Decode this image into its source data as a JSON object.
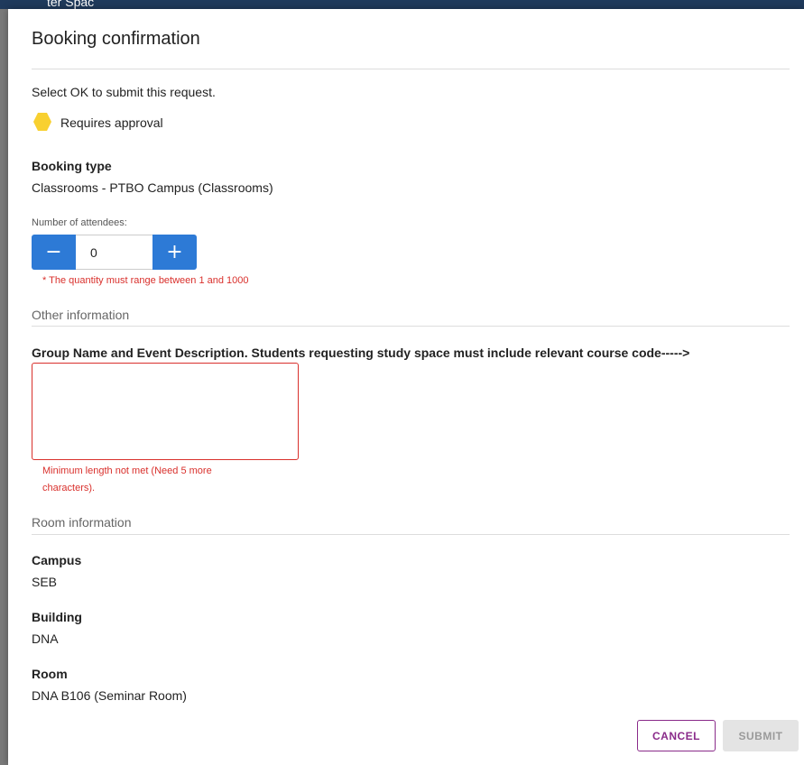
{
  "background": {
    "partial_text": "ter Spac"
  },
  "dialog": {
    "title": "Booking confirmation",
    "instruction": "Select OK to submit this request.",
    "approval": {
      "icon": "hexagon-icon",
      "color": "#f8d030",
      "label": "Requires approval"
    },
    "booking_type": {
      "label": "Booking type",
      "value": "Classrooms - PTBO Campus (Classrooms)"
    },
    "attendees": {
      "label": "Number of attendees:",
      "value": "0",
      "decrement": "−",
      "increment": "+",
      "error": "* The quantity must range between 1 and 1000"
    },
    "other_info": {
      "heading": "Other information",
      "question": "Group Name and Event Description. Students requesting study space must include relevant course code----->",
      "value": "",
      "error_line1": "Minimum length not met (Need 5 more",
      "error_line2": "characters)."
    },
    "room_info": {
      "heading": "Room information",
      "campus_label": "Campus",
      "campus_value": "SEB",
      "building_label": "Building",
      "building_value": "DNA",
      "room_label": "Room",
      "room_value": "DNA B106 (Seminar Room)"
    },
    "buttons": {
      "cancel": "CANCEL",
      "submit": "SUBMIT"
    }
  },
  "colors": {
    "accent_blue": "#2d7ad6",
    "error_red": "#d9302c",
    "cancel_purple": "#8a2b8a",
    "approval_yellow": "#f8d030"
  }
}
